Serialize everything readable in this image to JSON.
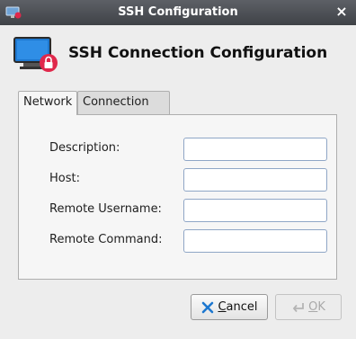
{
  "window": {
    "title": "SSH Configuration",
    "close_glyph": "×"
  },
  "header": {
    "title": "SSH Connection Configuration",
    "icon": "monitor-lock-icon"
  },
  "tabs": [
    {
      "label": "Network",
      "active": true
    },
    {
      "label": "Connection",
      "active": false
    }
  ],
  "form": {
    "fields": [
      {
        "label": "Description:",
        "value": ""
      },
      {
        "label": "Host:",
        "value": ""
      },
      {
        "label": "Remote Username:",
        "value": ""
      },
      {
        "label": "Remote Command:",
        "value": ""
      }
    ]
  },
  "buttons": {
    "cancel": {
      "mnemonic": "C",
      "rest": "ancel",
      "icon": "cancel-x-icon"
    },
    "ok": {
      "mnemonic": "O",
      "rest": "K",
      "icon": "enter-arrow-icon",
      "enabled": false
    }
  },
  "colors": {
    "accent": "#1e78d0",
    "badge": "#e0284b"
  }
}
